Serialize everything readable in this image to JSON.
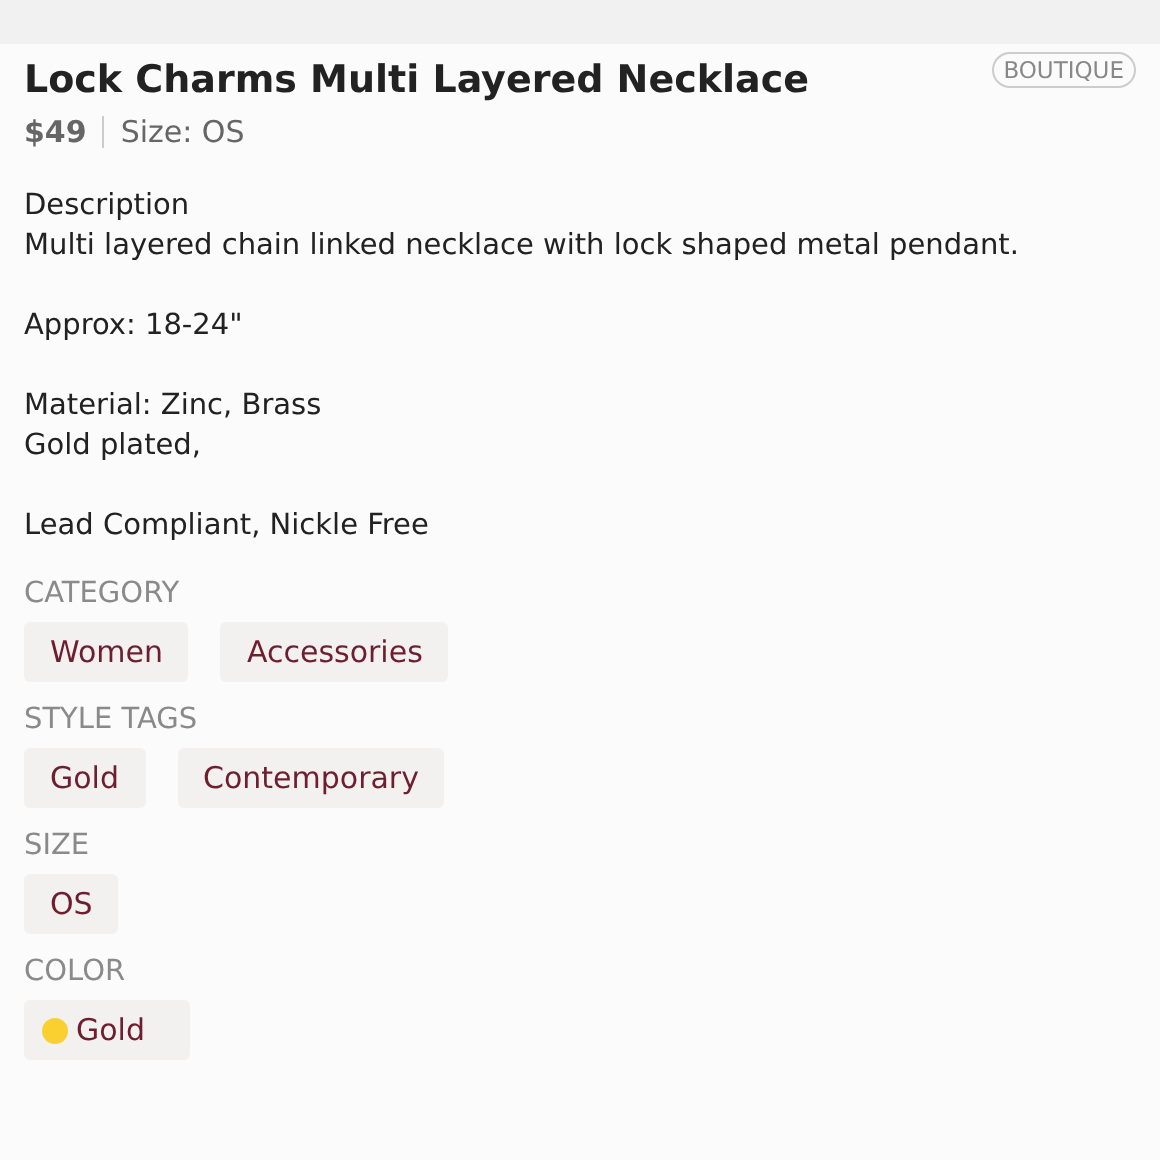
{
  "title": "Lock Charms Multi Layered Necklace",
  "badge": "BOUTIQUE",
  "price": "$49",
  "size_info": "Size: OS",
  "description_heading": "Description",
  "description_paragraphs": [
    [
      "Multi layered chain linked necklace with lock shaped metal pendant."
    ],
    [
      "Approx: 18-24\""
    ],
    [
      "Material: Zinc, Brass",
      "Gold plated,"
    ],
    [
      "Lead Compliant, Nickle Free"
    ]
  ],
  "sections": [
    {
      "label": "CATEGORY",
      "tags": [
        {
          "text": "Women"
        },
        {
          "text": "Accessories"
        }
      ]
    },
    {
      "label": "STYLE TAGS",
      "tags": [
        {
          "text": "Gold"
        },
        {
          "text": "Contemporary"
        }
      ]
    },
    {
      "label": "SIZE",
      "tags": [
        {
          "text": "OS"
        }
      ]
    },
    {
      "label": "COLOR",
      "tags": [
        {
          "text": "Gold",
          "color": "#f9d030"
        }
      ]
    }
  ]
}
